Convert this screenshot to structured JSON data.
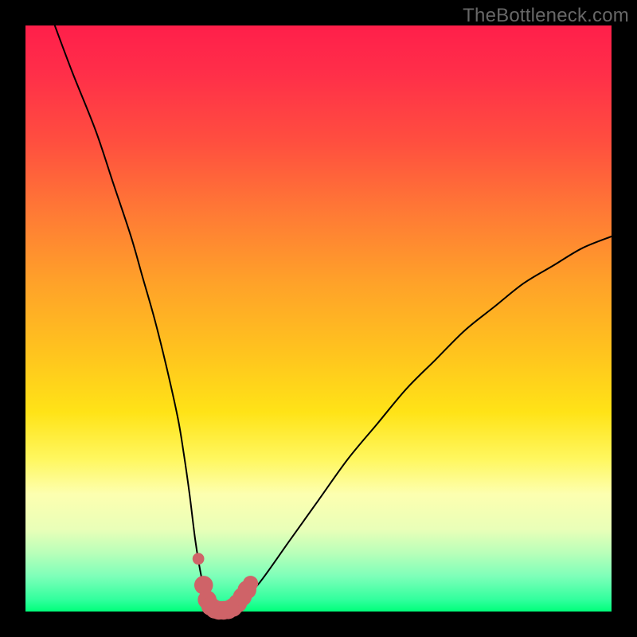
{
  "watermark": "TheBottleneck.com",
  "colors": {
    "background": "#000000",
    "curve_stroke": "#000000",
    "marker_stroke": "#cf6368",
    "marker_fill": "#cf6368",
    "watermark_text": "#676767"
  },
  "chart_data": {
    "type": "line",
    "title": "",
    "xlabel": "",
    "ylabel": "",
    "xlim": [
      0,
      100
    ],
    "ylim": [
      0,
      100
    ],
    "grid": false,
    "legend": null,
    "series": [
      {
        "name": "bottleneck-curve",
        "x": [
          5,
          8,
          12,
          15,
          18,
          20,
          22,
          24,
          26,
          27,
          28,
          29,
          30,
          31,
          32,
          33,
          34,
          35,
          37,
          40,
          45,
          50,
          55,
          60,
          65,
          70,
          75,
          80,
          85,
          90,
          95,
          100
        ],
        "y": [
          100,
          92,
          82,
          73,
          64,
          57,
          50,
          42,
          33,
          27,
          20,
          12,
          6,
          2,
          0.5,
          0,
          0,
          0.5,
          2,
          5,
          12,
          19,
          26,
          32,
          38,
          43,
          48,
          52,
          56,
          59,
          62,
          64
        ]
      }
    ],
    "markers": {
      "name": "minimum-band",
      "points": [
        {
          "x": 29.5,
          "y": 9,
          "r": 1.0
        },
        {
          "x": 30.4,
          "y": 4.5,
          "r": 1.6
        },
        {
          "x": 31.0,
          "y": 2.0,
          "r": 1.6
        },
        {
          "x": 31.6,
          "y": 0.9,
          "r": 1.6
        },
        {
          "x": 32.3,
          "y": 0.4,
          "r": 1.6
        },
        {
          "x": 33.0,
          "y": 0.2,
          "r": 1.6
        },
        {
          "x": 33.8,
          "y": 0.2,
          "r": 1.6
        },
        {
          "x": 34.6,
          "y": 0.3,
          "r": 1.6
        },
        {
          "x": 35.4,
          "y": 0.7,
          "r": 1.6
        },
        {
          "x": 36.2,
          "y": 1.4,
          "r": 1.6
        },
        {
          "x": 37.0,
          "y": 2.5,
          "r": 1.6
        },
        {
          "x": 37.8,
          "y": 3.7,
          "r": 1.6
        },
        {
          "x": 38.4,
          "y": 4.8,
          "r": 1.3
        }
      ]
    }
  }
}
